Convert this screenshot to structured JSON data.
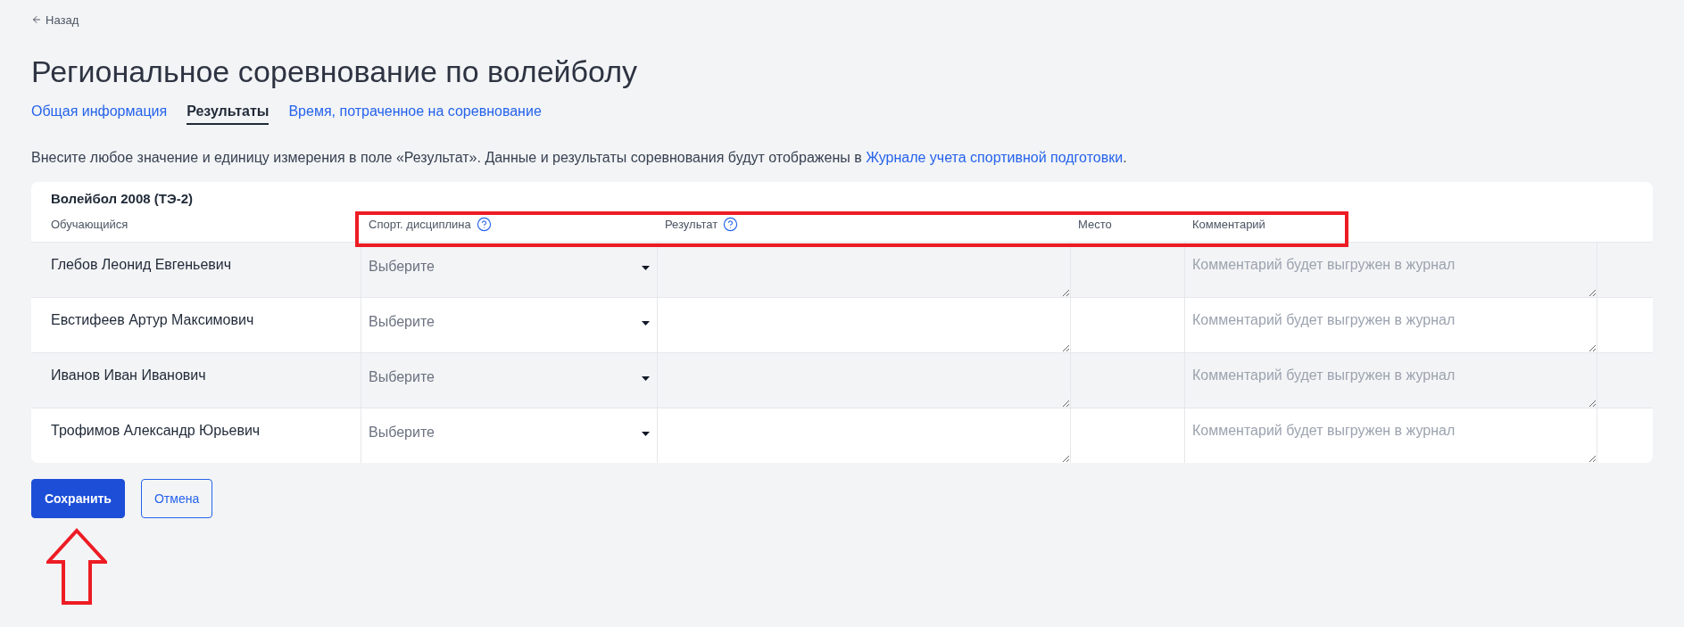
{
  "back_link": {
    "label": "Назад"
  },
  "title": "Региональное соревнование по волейболу",
  "tabs": [
    {
      "label": "Общая информация",
      "selected": false
    },
    {
      "label": "Результаты",
      "selected": true
    },
    {
      "label": "Время, потраченное на соревнование",
      "selected": false
    }
  ],
  "description": {
    "text": "Внесите любое значение и единицу измерения в поле «Результат». Данные и результаты соревнования будут отображены в ",
    "link": "Журнале учета спортивной подготовки",
    "end": "."
  },
  "table": {
    "title": "Волейбол 2008 (ТЭ-2)",
    "columns": [
      {
        "label": "Обучающийся",
        "help": false
      },
      {
        "label": "Спорт. дисциплина",
        "help": true
      },
      {
        "label": "Результат",
        "help": true
      },
      {
        "label": "Место",
        "help": false
      },
      {
        "label": "Комментарий",
        "help": false
      }
    ],
    "rows": [
      {
        "student": "Глебов Леонид Евгеньевич",
        "discipline_placeholder": "Выберите",
        "comment_placeholder": "Комментарий будет выгружен в журнал"
      },
      {
        "student": "Евстифеев Артур Максимович",
        "discipline_placeholder": "Выберите",
        "comment_placeholder": "Комментарий будет выгружен в журнал"
      },
      {
        "student": "Иванов Иван Иванович",
        "discipline_placeholder": "Выберите",
        "comment_placeholder": "Комментарий будет выгружен в журнал"
      },
      {
        "student": "Трофимов Александр Юрьевич",
        "discipline_placeholder": "Выберите",
        "comment_placeholder": "Комментарий будет выгружен в журнал"
      }
    ]
  },
  "buttons": [
    {
      "label": "Сохранить",
      "kind": "primary"
    },
    {
      "label": "Отмена",
      "kind": "secondary"
    }
  ],
  "annotations": {
    "highlight_frame": true,
    "arrow": true
  }
}
